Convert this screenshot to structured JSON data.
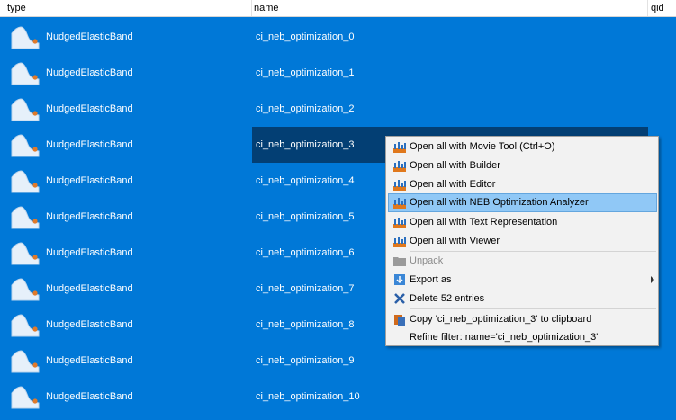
{
  "columns": {
    "type": "type",
    "name": "name",
    "qid": "qid"
  },
  "rows": [
    {
      "type": "NudgedElasticBand",
      "name": "ci_neb_optimization_0"
    },
    {
      "type": "NudgedElasticBand",
      "name": "ci_neb_optimization_1"
    },
    {
      "type": "NudgedElasticBand",
      "name": "ci_neb_optimization_2"
    },
    {
      "type": "NudgedElasticBand",
      "name": "ci_neb_optimization_3"
    },
    {
      "type": "NudgedElasticBand",
      "name": "ci_neb_optimization_4"
    },
    {
      "type": "NudgedElasticBand",
      "name": "ci_neb_optimization_5"
    },
    {
      "type": "NudgedElasticBand",
      "name": "ci_neb_optimization_6"
    },
    {
      "type": "NudgedElasticBand",
      "name": "ci_neb_optimization_7"
    },
    {
      "type": "NudgedElasticBand",
      "name": "ci_neb_optimization_8"
    },
    {
      "type": "NudgedElasticBand",
      "name": "ci_neb_optimization_9"
    },
    {
      "type": "NudgedElasticBand",
      "name": "ci_neb_optimization_10"
    }
  ],
  "context_menu": {
    "movie_tool": "Open all with Movie Tool (Ctrl+O)",
    "builder": "Open all with Builder",
    "editor": "Open all with Editor",
    "neb_analyzer": "Open all with NEB Optimization Analyzer",
    "text_repr": "Open all with Text Representation",
    "viewer": "Open all with Viewer",
    "unpack": "Unpack",
    "export_as": "Export as",
    "delete": "Delete 52 entries",
    "copy": "Copy 'ci_neb_optimization_3' to clipboard",
    "refine": "Refine filter: name='ci_neb_optimization_3'"
  },
  "colors": {
    "selection_background": "#0078d7",
    "focused_cell": "#033f74",
    "menu_highlight": "#90c8f6"
  }
}
